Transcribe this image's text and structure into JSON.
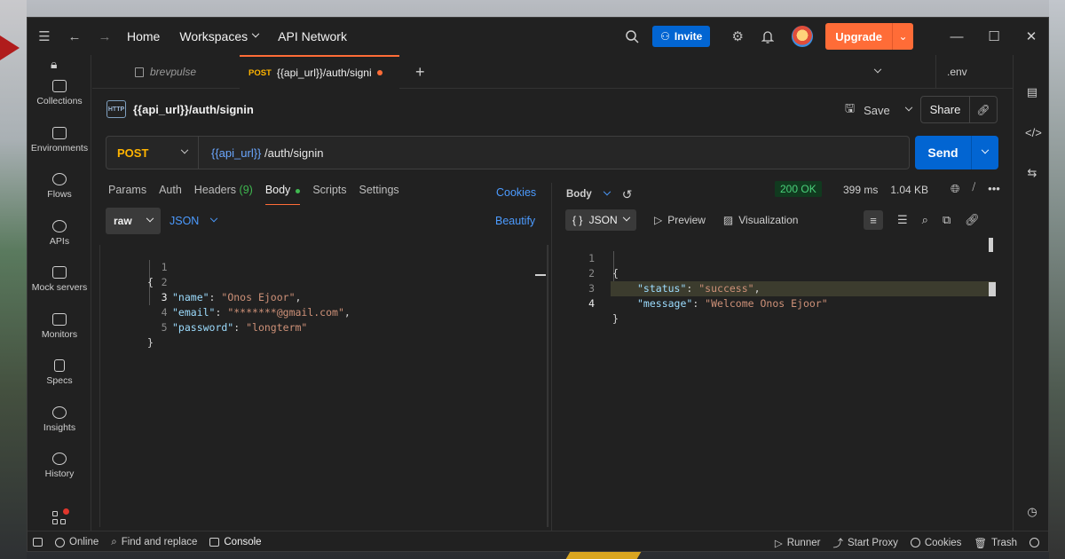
{
  "titlebar": {
    "nav": [
      "Home",
      "Workspaces",
      "API Network"
    ],
    "invite_label": "Invite",
    "upgrade_label": "Upgrade"
  },
  "sidebar": {
    "items": [
      {
        "label": "Collections",
        "icon": "collections-icon"
      },
      {
        "label": "Environments",
        "icon": "environments-icon"
      },
      {
        "label": "Flows",
        "icon": "flows-icon"
      },
      {
        "label": "APIs",
        "icon": "apis-icon"
      },
      {
        "label": "Mock servers",
        "icon": "mock-servers-icon"
      },
      {
        "label": "Monitors",
        "icon": "monitors-icon"
      },
      {
        "label": "Specs",
        "icon": "specs-icon"
      },
      {
        "label": "Insights",
        "icon": "insights-icon"
      },
      {
        "label": "History",
        "icon": "history-icon"
      }
    ]
  },
  "tabs": {
    "inactive_label": "brevpulse",
    "active_method": "POST",
    "active_label": "{{api_url}}/auth/signi",
    "environment": ".env"
  },
  "request": {
    "title": "{{api_url}}/auth/signin",
    "save_label": "Save",
    "share_label": "Share",
    "method": "POST",
    "url_var": "{{api_url}}",
    "url_path": " /auth/signin",
    "send_label": "Send",
    "tabs": {
      "params": "Params",
      "auth": "Auth",
      "headers": "Headers",
      "headers_count": "(9)",
      "body": "Body",
      "scripts": "Scripts",
      "settings": "Settings"
    },
    "cookies_label": "Cookies",
    "body_mode": "raw",
    "body_format": "JSON",
    "beautify_label": "Beautify",
    "code": {
      "lines": [
        "1",
        "2",
        "3",
        "4",
        "5"
      ],
      "open": "{",
      "k1": "\"name\"",
      "v1": "\"Onos Ejoor\"",
      "k2": "\"email\"",
      "v2": "\"*******@gmail.com\"",
      "k3": "\"password\"",
      "v3": "\"longterm\"",
      "close": "}"
    }
  },
  "response": {
    "body_label": "Body",
    "status": "200 OK",
    "time": "399 ms",
    "size": "1.04 KB",
    "format": "JSON",
    "preview_label": "Preview",
    "visualization_label": "Visualization",
    "code": {
      "lines": [
        "1",
        "2",
        "3",
        "4"
      ],
      "open": "{",
      "k1": "\"status\"",
      "v1": "\"success\"",
      "k2": "\"message\"",
      "v2": "\"Welcome Onos Ejoor\"",
      "close": "}"
    }
  },
  "statusbar": {
    "online": "Online",
    "find_replace": "Find and replace",
    "console": "Console",
    "runner": "Runner",
    "start_proxy": "Start Proxy",
    "cookies": "Cookies",
    "trash": "Trash"
  },
  "colors": {
    "accent_orange": "#ff6c37",
    "primary_blue": "#0265d2",
    "method_post": "#ffb400",
    "status_ok": "#4ad17a"
  }
}
